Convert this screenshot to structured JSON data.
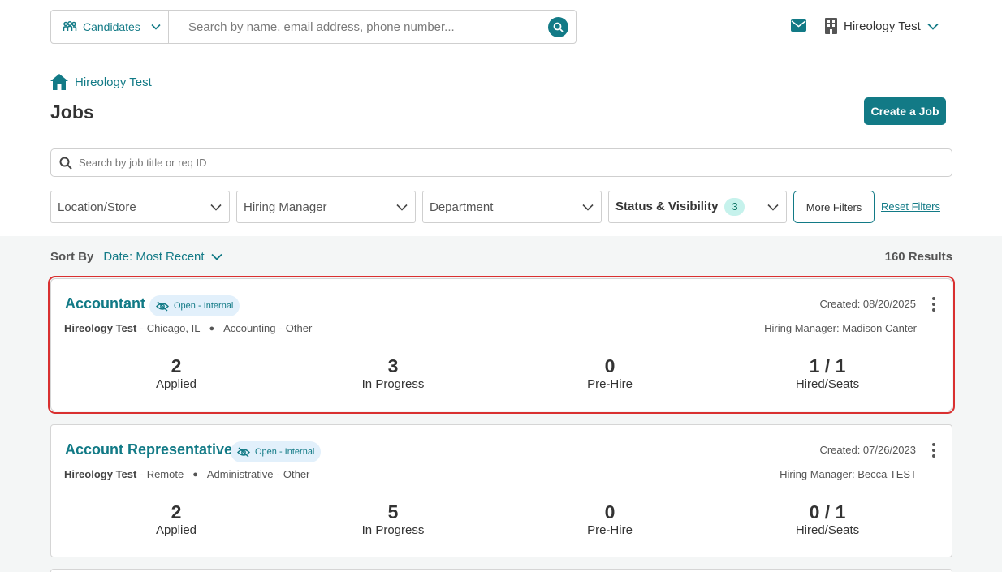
{
  "header": {
    "candidates_label": "Candidates",
    "search_placeholder": "Search by name, email address, phone number...",
    "org_name": "Hireology Test"
  },
  "breadcrumb": {
    "label": "Hireology Test"
  },
  "page": {
    "title": "Jobs",
    "create_label": "Create a Job"
  },
  "job_search": {
    "placeholder": "Search by job title or req ID"
  },
  "filters": {
    "location": "Location/Store",
    "hiring_manager": "Hiring Manager",
    "department": "Department",
    "status": "Status & Visibility",
    "status_count": "3",
    "more": "More Filters",
    "reset": "Reset Filters"
  },
  "sort": {
    "label": "Sort By",
    "value": "Date: Most Recent",
    "results": "160 Results"
  },
  "jobs": [
    {
      "title": "Accountant",
      "visibility": "Open - Internal",
      "created": "Created: 08/20/2025",
      "org": "Hireology Test",
      "location": "Chicago, IL",
      "department": "Accounting",
      "type": "Other",
      "hiring_manager": "Hiring Manager: Madison Canter",
      "applied": "2",
      "applied_label": "Applied",
      "in_progress": "3",
      "in_progress_label": "In Progress",
      "pre_hire": "0",
      "pre_hire_label": "Pre-Hire",
      "hired": "1 / 1",
      "hired_label": "Hired/Seats"
    },
    {
      "title": "Account Representative",
      "visibility": "Open - Internal",
      "created": "Created: 07/26/2023",
      "org": "Hireology Test",
      "location": "Remote",
      "department": "Administrative",
      "type": "Other",
      "hiring_manager": "Hiring Manager: Becca TEST",
      "applied": "2",
      "applied_label": "Applied",
      "in_progress": "5",
      "in_progress_label": "In Progress",
      "pre_hire": "0",
      "pre_hire_label": "Pre-Hire",
      "hired": "0 / 1",
      "hired_label": "Hired/Seats"
    }
  ],
  "colors": {
    "accent": "#127a86",
    "selected_outline": "#d93030",
    "badge_bg": "#e2f0fb"
  }
}
